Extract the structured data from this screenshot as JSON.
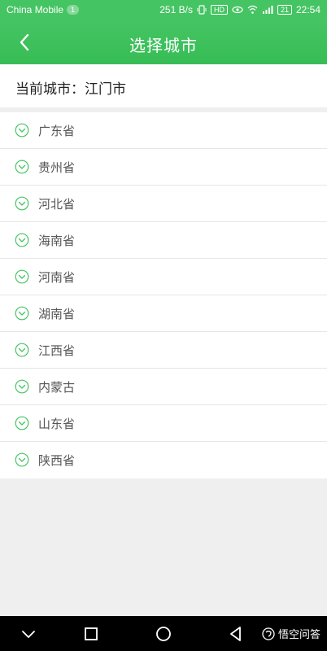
{
  "status_bar": {
    "carrier": "China Mobile",
    "sim_badge": "1",
    "net_speed": "251 B/s",
    "hd_badge": "HD",
    "battery": "21",
    "time": "22:54"
  },
  "header": {
    "title": "选择城市",
    "back_icon": "chevron-left-icon"
  },
  "current_city": {
    "text": "当前城市：江门市"
  },
  "provinces": [
    {
      "label": "广东省"
    },
    {
      "label": "贵州省"
    },
    {
      "label": "河北省"
    },
    {
      "label": "海南省"
    },
    {
      "label": "河南省"
    },
    {
      "label": "湖南省"
    },
    {
      "label": "江西省"
    },
    {
      "label": "内蒙古"
    },
    {
      "label": "山东省"
    },
    {
      "label": "陕西省"
    }
  ],
  "nav_bar": {
    "watermark": "悟空问答"
  },
  "colors": {
    "accent": "#45c463",
    "text": "#555555",
    "divider": "#e6e6e6",
    "background": "#efefef"
  }
}
